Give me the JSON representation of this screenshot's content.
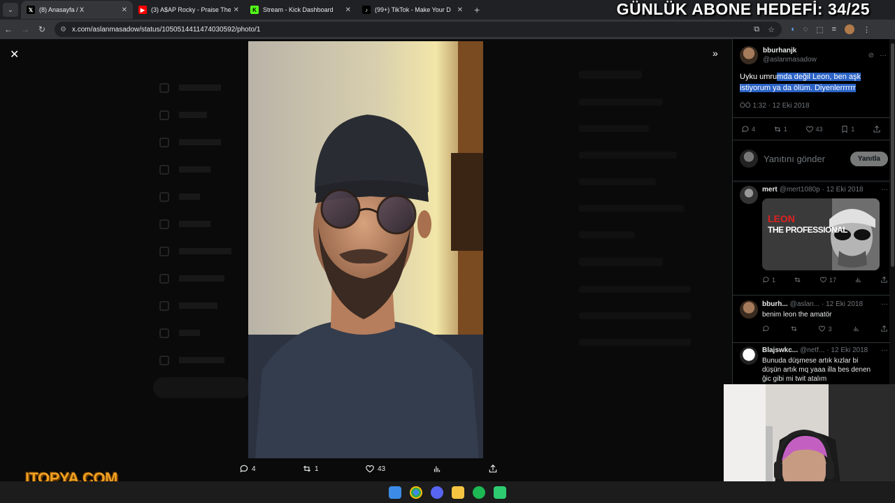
{
  "browser": {
    "tabs": [
      {
        "title": "(8) Anasayfa / X",
        "favicon": "x-logo",
        "active": true
      },
      {
        "title": "(3) A$AP Rocky - Praise The",
        "favicon": "youtube-logo",
        "active": false
      },
      {
        "title": "Stream - Kick Dashboard",
        "favicon": "kick-logo",
        "active": false
      },
      {
        "title": "(99+) TikTok - Make Your D",
        "favicon": "tiktok-logo",
        "active": false
      }
    ],
    "url": "x.com/aslanmasadow/status/1050514411474030592/photo/1"
  },
  "overlay": {
    "goal_text": "GÜNLÜK ABONE HEDEFİ: 34/25",
    "brand": "ITOPYA.COM"
  },
  "media_viewer": {
    "actions": {
      "replies": "4",
      "reposts": "1",
      "likes": "43"
    }
  },
  "tweet": {
    "display_name": "bburhanjk",
    "username": "@aslanmasadow",
    "text_plain": "Uyku umru",
    "text_selected_1": "mda değil Leon, ben aşk",
    "text_selected_2": "istiyorum ya da ölüm. Diyenlerrrrrr",
    "time": "ÖÖ 1:32 · 12 Eki 2018",
    "replies": "4",
    "reposts": "1",
    "likes": "43",
    "bookmarks": "1"
  },
  "reply_box": {
    "placeholder": "Yanıtını gönder",
    "button": "Yanıtla"
  },
  "replies": [
    {
      "display_name": "mert",
      "username": "@mert1080p",
      "date": "· 12 Eki 2018",
      "media_text_1": "LEON",
      "media_text_2": "THE PROFESSIONAL",
      "replies": "1",
      "reposts": "",
      "likes": "17"
    },
    {
      "display_name": "bburh...",
      "username": "@aslan...",
      "date": "· 12 Eki 2018",
      "text": "benim leon the amatör",
      "replies": "",
      "reposts": "",
      "likes": "3"
    },
    {
      "display_name": "Blajswkc...",
      "username": "@netf...",
      "date": "· 12 Eki 2018",
      "text": "Bunuda düşmese artık kızlar bi düşün artık mq yaaa illa bes denen ğic gibi mi twit atalım"
    }
  ],
  "colors": {
    "accent_blue": "#2b63c6",
    "text_muted": "#71767b",
    "brand_orange": "#f0a021"
  }
}
